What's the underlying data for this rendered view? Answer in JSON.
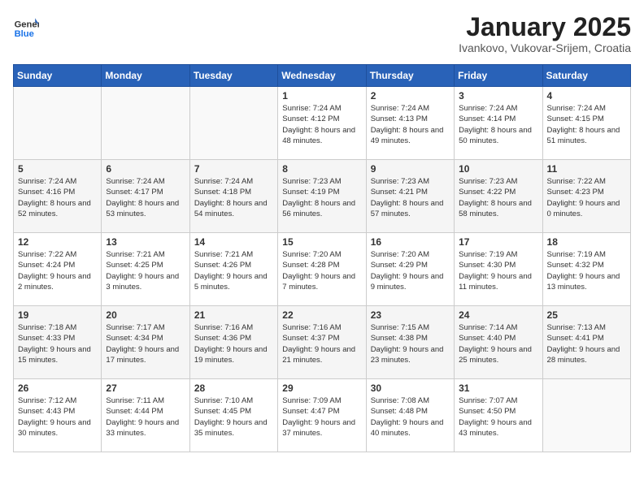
{
  "header": {
    "logo_general": "General",
    "logo_blue": "Blue",
    "title": "January 2025",
    "subtitle": "Ivankovo, Vukovar-Srijem, Croatia"
  },
  "days_of_week": [
    "Sunday",
    "Monday",
    "Tuesday",
    "Wednesday",
    "Thursday",
    "Friday",
    "Saturday"
  ],
  "weeks": [
    [
      {
        "day": "",
        "info": ""
      },
      {
        "day": "",
        "info": ""
      },
      {
        "day": "",
        "info": ""
      },
      {
        "day": "1",
        "info": "Sunrise: 7:24 AM\nSunset: 4:12 PM\nDaylight: 8 hours\nand 48 minutes."
      },
      {
        "day": "2",
        "info": "Sunrise: 7:24 AM\nSunset: 4:13 PM\nDaylight: 8 hours\nand 49 minutes."
      },
      {
        "day": "3",
        "info": "Sunrise: 7:24 AM\nSunset: 4:14 PM\nDaylight: 8 hours\nand 50 minutes."
      },
      {
        "day": "4",
        "info": "Sunrise: 7:24 AM\nSunset: 4:15 PM\nDaylight: 8 hours\nand 51 minutes."
      }
    ],
    [
      {
        "day": "5",
        "info": "Sunrise: 7:24 AM\nSunset: 4:16 PM\nDaylight: 8 hours\nand 52 minutes."
      },
      {
        "day": "6",
        "info": "Sunrise: 7:24 AM\nSunset: 4:17 PM\nDaylight: 8 hours\nand 53 minutes."
      },
      {
        "day": "7",
        "info": "Sunrise: 7:24 AM\nSunset: 4:18 PM\nDaylight: 8 hours\nand 54 minutes."
      },
      {
        "day": "8",
        "info": "Sunrise: 7:23 AM\nSunset: 4:19 PM\nDaylight: 8 hours\nand 56 minutes."
      },
      {
        "day": "9",
        "info": "Sunrise: 7:23 AM\nSunset: 4:21 PM\nDaylight: 8 hours\nand 57 minutes."
      },
      {
        "day": "10",
        "info": "Sunrise: 7:23 AM\nSunset: 4:22 PM\nDaylight: 8 hours\nand 58 minutes."
      },
      {
        "day": "11",
        "info": "Sunrise: 7:22 AM\nSunset: 4:23 PM\nDaylight: 9 hours\nand 0 minutes."
      }
    ],
    [
      {
        "day": "12",
        "info": "Sunrise: 7:22 AM\nSunset: 4:24 PM\nDaylight: 9 hours\nand 2 minutes."
      },
      {
        "day": "13",
        "info": "Sunrise: 7:21 AM\nSunset: 4:25 PM\nDaylight: 9 hours\nand 3 minutes."
      },
      {
        "day": "14",
        "info": "Sunrise: 7:21 AM\nSunset: 4:26 PM\nDaylight: 9 hours\nand 5 minutes."
      },
      {
        "day": "15",
        "info": "Sunrise: 7:20 AM\nSunset: 4:28 PM\nDaylight: 9 hours\nand 7 minutes."
      },
      {
        "day": "16",
        "info": "Sunrise: 7:20 AM\nSunset: 4:29 PM\nDaylight: 9 hours\nand 9 minutes."
      },
      {
        "day": "17",
        "info": "Sunrise: 7:19 AM\nSunset: 4:30 PM\nDaylight: 9 hours\nand 11 minutes."
      },
      {
        "day": "18",
        "info": "Sunrise: 7:19 AM\nSunset: 4:32 PM\nDaylight: 9 hours\nand 13 minutes."
      }
    ],
    [
      {
        "day": "19",
        "info": "Sunrise: 7:18 AM\nSunset: 4:33 PM\nDaylight: 9 hours\nand 15 minutes."
      },
      {
        "day": "20",
        "info": "Sunrise: 7:17 AM\nSunset: 4:34 PM\nDaylight: 9 hours\nand 17 minutes."
      },
      {
        "day": "21",
        "info": "Sunrise: 7:16 AM\nSunset: 4:36 PM\nDaylight: 9 hours\nand 19 minutes."
      },
      {
        "day": "22",
        "info": "Sunrise: 7:16 AM\nSunset: 4:37 PM\nDaylight: 9 hours\nand 21 minutes."
      },
      {
        "day": "23",
        "info": "Sunrise: 7:15 AM\nSunset: 4:38 PM\nDaylight: 9 hours\nand 23 minutes."
      },
      {
        "day": "24",
        "info": "Sunrise: 7:14 AM\nSunset: 4:40 PM\nDaylight: 9 hours\nand 25 minutes."
      },
      {
        "day": "25",
        "info": "Sunrise: 7:13 AM\nSunset: 4:41 PM\nDaylight: 9 hours\nand 28 minutes."
      }
    ],
    [
      {
        "day": "26",
        "info": "Sunrise: 7:12 AM\nSunset: 4:43 PM\nDaylight: 9 hours\nand 30 minutes."
      },
      {
        "day": "27",
        "info": "Sunrise: 7:11 AM\nSunset: 4:44 PM\nDaylight: 9 hours\nand 33 minutes."
      },
      {
        "day": "28",
        "info": "Sunrise: 7:10 AM\nSunset: 4:45 PM\nDaylight: 9 hours\nand 35 minutes."
      },
      {
        "day": "29",
        "info": "Sunrise: 7:09 AM\nSunset: 4:47 PM\nDaylight: 9 hours\nand 37 minutes."
      },
      {
        "day": "30",
        "info": "Sunrise: 7:08 AM\nSunset: 4:48 PM\nDaylight: 9 hours\nand 40 minutes."
      },
      {
        "day": "31",
        "info": "Sunrise: 7:07 AM\nSunset: 4:50 PM\nDaylight: 9 hours\nand 43 minutes."
      },
      {
        "day": "",
        "info": ""
      }
    ]
  ]
}
